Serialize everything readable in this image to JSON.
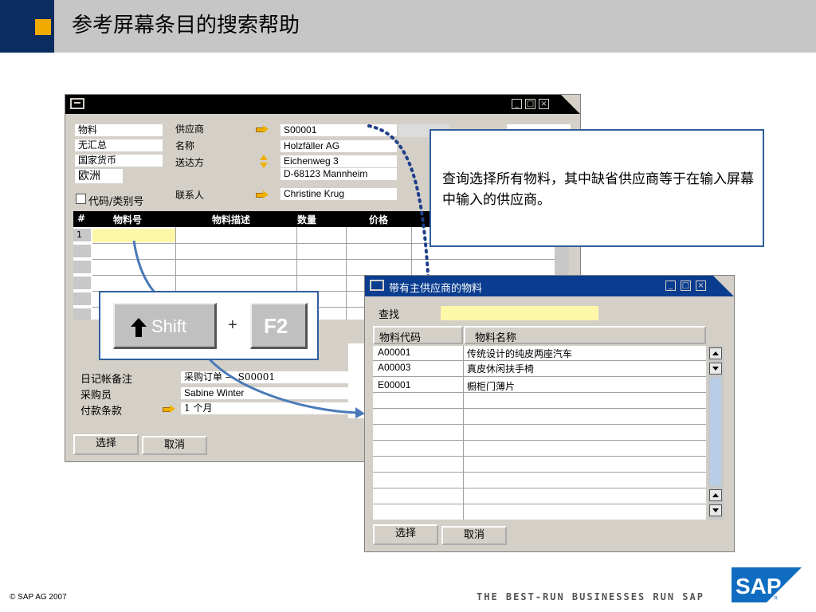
{
  "slide": {
    "title": "参考屏幕条目的搜索帮助",
    "footer_copyright": "©  SAP AG 2007",
    "footer_tagline": "THE BEST-RUN BUSINESSES RUN SAP",
    "logo_text": "SAP"
  },
  "colors": {
    "header_bg": "#c6c6c6",
    "header_blue": "#0a2c5f",
    "header_orange": "#f0ab00",
    "callout_border": "#2f5e9e",
    "window_bg": "#d4d0c8",
    "sap_blue": "#0f6cc0"
  },
  "main_window": {
    "left_fields": [
      "物料",
      "无汇总",
      "国家货币",
      "欧洲"
    ],
    "checkbox_label": "代码/类别号",
    "vendor_label": "供应商",
    "vendor_value": "S00001",
    "name_label": "名称",
    "name_value": "Holzfäller AG",
    "ship_label": "送达方",
    "ship_value_line1": "Eichenweg 3",
    "ship_value_line2": "D-68123 Mannheim",
    "contact_label": "联系人",
    "contact_value": "Christine Krug",
    "grid_headers": [
      "#",
      "物料号",
      "物料描述",
      "数量",
      "价格"
    ],
    "row_number": "1",
    "journal_label": "日记帐备注",
    "journal_value": "采购订单 — S00001",
    "buyer_label": "采购员",
    "buyer_value": "Sabine Winter",
    "payment_label": "付款条款",
    "payment_value": "1 个月",
    "select_button": "选择",
    "cancel_button": "取消"
  },
  "callout": {
    "text": "查询选择所有物料，其中缺省供应商等于在输入屏幕中输入的供应商。"
  },
  "keys": {
    "shift_label": "Shift",
    "plus": "+",
    "f2_label": "F2"
  },
  "popup_window": {
    "title": "带有主供应商的物料",
    "search_label": "查找",
    "search_value": "",
    "col_code": "物料代码",
    "col_name": "物料名称",
    "rows": [
      {
        "code": "A00001",
        "name": "传统设计的纯皮两座汽车"
      },
      {
        "code": "A00003",
        "name": "真皮休闲扶手椅"
      },
      {
        "code": "E00001",
        "name": "橱柜门薄片"
      }
    ],
    "select_button": "选择",
    "cancel_button": "取消"
  }
}
